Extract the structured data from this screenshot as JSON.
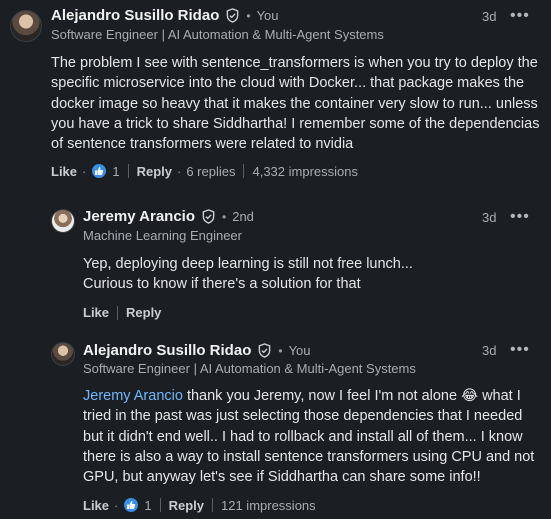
{
  "comments": [
    {
      "author": "Alejandro Susillo Ridao",
      "relation": "You",
      "subtitle": "Software Engineer | AI Automation & Multi-Agent Systems",
      "time": "3d",
      "text": "The problem I see with sentence_transformers is when you try to deploy the specific microservice into the cloud with Docker... that package makes the docker image so heavy that it makes the container very slow to run... unless you have a trick to share Siddhartha! I remember some of the dependencias of sentence transformers were related to nvidia",
      "like_label": "Like",
      "like_count": "1",
      "reply_label": "Reply",
      "replies": "6 replies",
      "impressions": "4,332 impressions"
    },
    {
      "author": "Jeremy Arancio",
      "relation": "2nd",
      "subtitle": "Machine Learning Engineer",
      "time": "3d",
      "text_line1": "Yep, deploying deep learning is still not free lunch...",
      "text_line2": "Curious to know if there's a solution for that",
      "like_label": "Like",
      "reply_label": "Reply"
    },
    {
      "author": "Alejandro Susillo Ridao",
      "relation": "You",
      "subtitle": "Software Engineer | AI Automation & Multi-Agent Systems",
      "time": "3d",
      "mention": "Jeremy Arancio",
      "text_part1": " thank you Jeremy, now I feel I'm not alone ",
      "emoji": "😂",
      "text_part2": " what I tried in the past was just selecting those dependencies that I needed but it didn't end well.. I had to rollback and install all of them... I know there is also a way to install sentence transformers using CPU and not GPU, but anyway let's see if Siddhartha can share some info!!",
      "like_label": "Like",
      "like_count": "1",
      "reply_label": "Reply",
      "impressions": "121 impressions"
    }
  ],
  "icons": {
    "verified": "verified-shield-icon",
    "menu": "more-horizontal-icon",
    "reaction": "thumbs-up-reaction-icon"
  },
  "colors": {
    "background": "#1b1f23",
    "accent": "#378fe9",
    "mention": "#71b7fb"
  }
}
